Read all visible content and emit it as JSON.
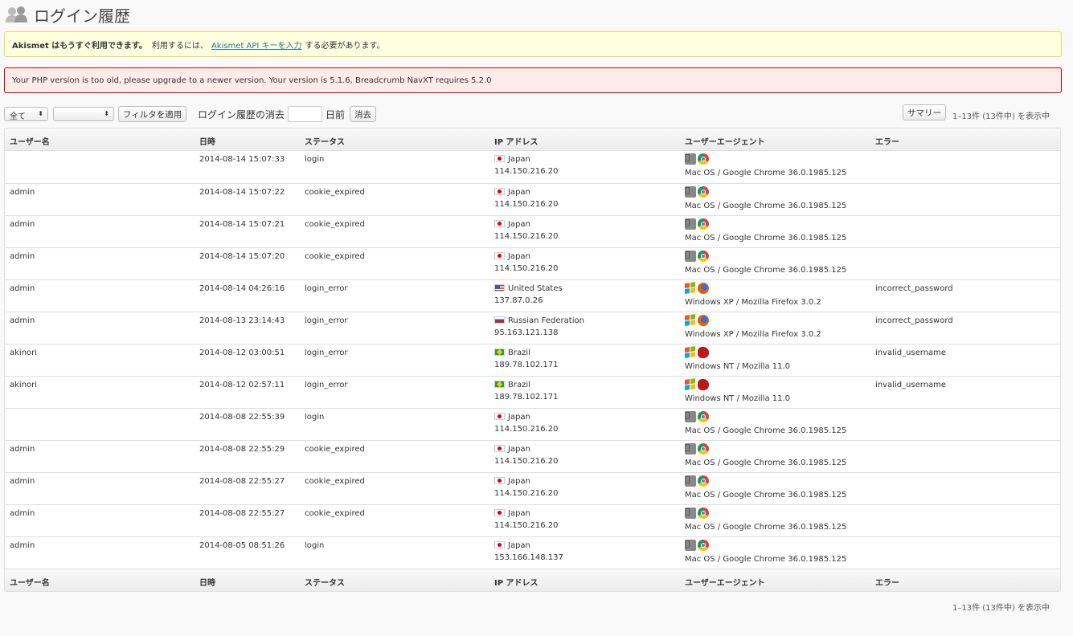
{
  "page": {
    "title": "ログイン履歴"
  },
  "notices": {
    "akismet": {
      "bold": "Akismet はもうすぐ利用できます。",
      "before_link": "利用するには、",
      "link": "Akismet API キーを入力",
      "after_link": "する必要があります。"
    },
    "php_error": "Your PHP version is too old, please upgrade to a newer version. Your version is 5.1.6, Breadcrumb NavXT requires 5.2.0"
  },
  "toolbar": {
    "filter_select": "全て",
    "second_select": "",
    "apply_filter": "フィルタを適用",
    "delete_label": "ログイン履歴の消去",
    "days_value": "",
    "days_suffix": "日前",
    "delete_button": "消去",
    "summary_button": "サマリー",
    "count_text": "1–13件 (13件中) を表示中"
  },
  "columns": {
    "user": "ユーザー名",
    "date": "日時",
    "status": "ステータス",
    "ip": "IP アドレス",
    "ua": "ユーザーエージェント",
    "error": "エラー"
  },
  "rows": [
    {
      "user": "",
      "date": "2014-08-14 15:07:33",
      "status": "login",
      "flag": "jp",
      "country": "Japan",
      "ip": "114.150.216.20",
      "icons": [
        "apple-icon",
        "chrome-icon"
      ],
      "ua": "Mac OS / Google Chrome 36.0.1985.125",
      "error": ""
    },
    {
      "user": "admin",
      "date": "2014-08-14 15:07:22",
      "status": "cookie_expired",
      "flag": "jp",
      "country": "Japan",
      "ip": "114.150.216.20",
      "icons": [
        "apple-icon",
        "chrome-icon"
      ],
      "ua": "Mac OS / Google Chrome 36.0.1985.125",
      "error": ""
    },
    {
      "user": "admin",
      "date": "2014-08-14 15:07:21",
      "status": "cookie_expired",
      "flag": "jp",
      "country": "Japan",
      "ip": "114.150.216.20",
      "icons": [
        "apple-icon",
        "chrome-icon"
      ],
      "ua": "Mac OS / Google Chrome 36.0.1985.125",
      "error": ""
    },
    {
      "user": "admin",
      "date": "2014-08-14 15:07:20",
      "status": "cookie_expired",
      "flag": "jp",
      "country": "Japan",
      "ip": "114.150.216.20",
      "icons": [
        "apple-icon",
        "chrome-icon"
      ],
      "ua": "Mac OS / Google Chrome 36.0.1985.125",
      "error": ""
    },
    {
      "user": "admin",
      "date": "2014-08-14 04:26:16",
      "status": "login_error",
      "flag": "us",
      "country": "United States",
      "ip": "137.87.0.26",
      "icons": [
        "windows-icon",
        "firefox-icon"
      ],
      "ua": "Windows XP / Mozilla Firefox 3.0.2",
      "error": "incorrect_password"
    },
    {
      "user": "admin",
      "date": "2014-08-13 23:14:43",
      "status": "login_error",
      "flag": "ru",
      "country": "Russian Federation",
      "ip": "95.163.121.138",
      "icons": [
        "windows-icon",
        "firefox-icon"
      ],
      "ua": "Windows XP / Mozilla Firefox 3.0.2",
      "error": "incorrect_password"
    },
    {
      "user": "akinori",
      "date": "2014-08-12 03:00:51",
      "status": "login_error",
      "flag": "br",
      "country": "Brazil",
      "ip": "189.78.102.171",
      "icons": [
        "windows-icon",
        "mozilla-icon"
      ],
      "ua": "Windows NT / Mozilla 11.0",
      "error": "invalid_username"
    },
    {
      "user": "akinori",
      "date": "2014-08-12 02:57:11",
      "status": "login_error",
      "flag": "br",
      "country": "Brazil",
      "ip": "189.78.102.171",
      "icons": [
        "windows-icon",
        "mozilla-icon"
      ],
      "ua": "Windows NT / Mozilla 11.0",
      "error": "invalid_username"
    },
    {
      "user": "",
      "date": "2014-08-08 22:55:39",
      "status": "login",
      "flag": "jp",
      "country": "Japan",
      "ip": "114.150.216.20",
      "icons": [
        "apple-icon",
        "chrome-icon"
      ],
      "ua": "Mac OS / Google Chrome 36.0.1985.125",
      "error": ""
    },
    {
      "user": "admin",
      "date": "2014-08-08 22:55:29",
      "status": "cookie_expired",
      "flag": "jp",
      "country": "Japan",
      "ip": "114.150.216.20",
      "icons": [
        "apple-icon",
        "chrome-icon"
      ],
      "ua": "Mac OS / Google Chrome 36.0.1985.125",
      "error": ""
    },
    {
      "user": "admin",
      "date": "2014-08-08 22:55:27",
      "status": "cookie_expired",
      "flag": "jp",
      "country": "Japan",
      "ip": "114.150.216.20",
      "icons": [
        "apple-icon",
        "chrome-icon"
      ],
      "ua": "Mac OS / Google Chrome 36.0.1985.125",
      "error": ""
    },
    {
      "user": "admin",
      "date": "2014-08-08 22:55:27",
      "status": "cookie_expired",
      "flag": "jp",
      "country": "Japan",
      "ip": "114.150.216.20",
      "icons": [
        "apple-icon",
        "chrome-icon"
      ],
      "ua": "Mac OS / Google Chrome 36.0.1985.125",
      "error": ""
    },
    {
      "user": "admin",
      "date": "2014-08-05 08:51:26",
      "status": "login",
      "flag": "jp",
      "country": "Japan",
      "ip": "153.166.148.137",
      "icons": [
        "apple-icon",
        "chrome-icon"
      ],
      "ua": "Mac OS / Google Chrome 36.0.1985.125",
      "error": ""
    }
  ]
}
